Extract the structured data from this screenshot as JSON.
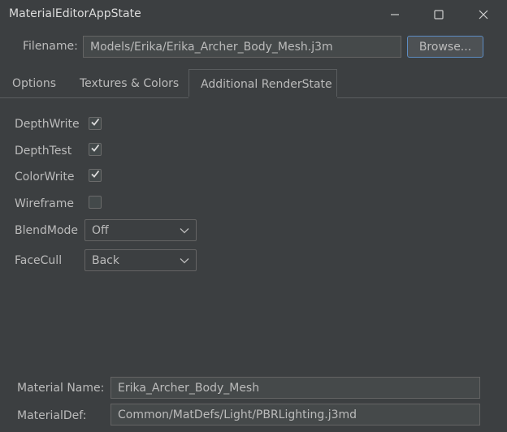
{
  "window": {
    "title": "MaterialEditorAppState",
    "minimize_icon": "minimize-icon",
    "maximize_icon": "maximize-icon",
    "close_icon": "close-icon"
  },
  "file": {
    "label": "Filename:",
    "value": "Models/Erika/Erika_Archer_Body_Mesh.j3m",
    "browse_label": "Browse..."
  },
  "tabs": [
    {
      "label": "Options",
      "active": false
    },
    {
      "label": "Textures & Colors",
      "active": false
    },
    {
      "label": "Additional RenderState",
      "active": true
    }
  ],
  "render_state": {
    "depth_write": {
      "label": "DepthWrite",
      "checked": true
    },
    "depth_test": {
      "label": "DepthTest",
      "checked": true
    },
    "color_write": {
      "label": "ColorWrite",
      "checked": true
    },
    "wireframe": {
      "label": "Wireframe",
      "checked": false
    },
    "blend_mode": {
      "label": "BlendMode",
      "value": "Off"
    },
    "face_cull": {
      "label": "FaceCull",
      "value": "Back"
    }
  },
  "material": {
    "name_label": "Material Name:",
    "name_value": "Erika_Archer_Body_Mesh",
    "def_label": "MaterialDef:",
    "def_value": "Common/MatDefs/Light/PBRLighting.j3md"
  },
  "colors": {
    "background": "#3c3f41",
    "field_background": "#45494a",
    "text": "#bbbbbb",
    "accent_border": "#5d8cc2"
  }
}
